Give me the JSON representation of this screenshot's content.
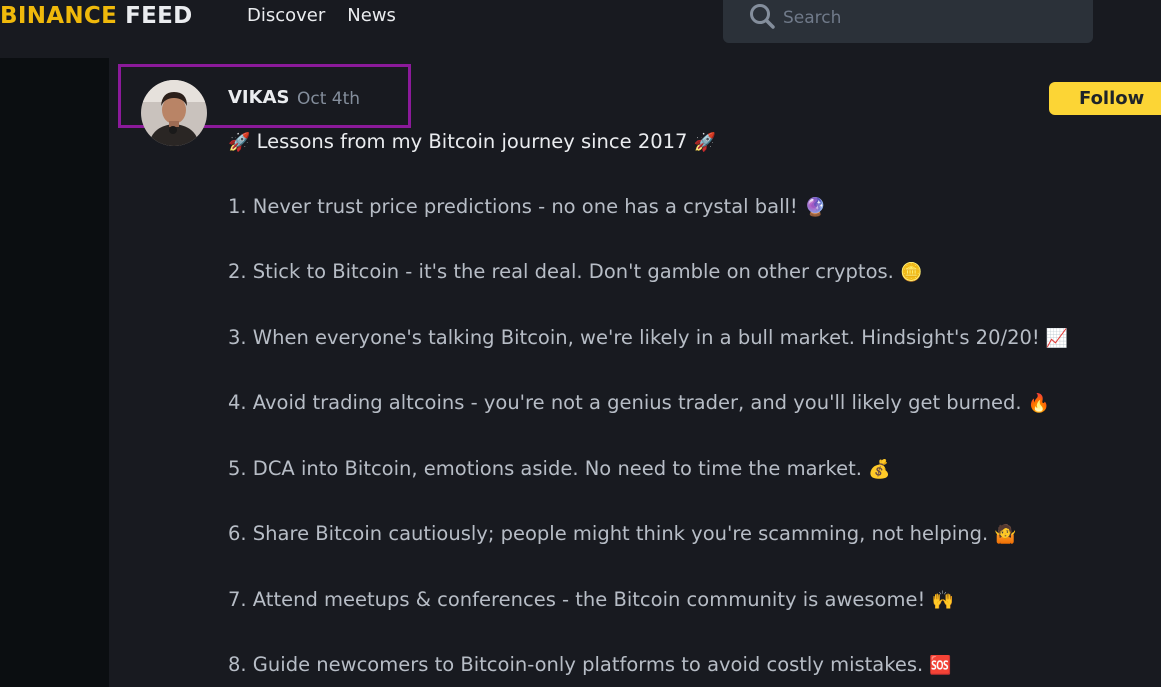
{
  "header": {
    "brand": "BINANCE",
    "feed": "FEED",
    "nav": [
      "Discover",
      "News"
    ],
    "search_placeholder": "Search"
  },
  "post": {
    "author": "VIKAS",
    "date": "Oct 4th",
    "follow_label": "Follow",
    "lines": [
      {
        "text": "Lessons from my Bitcoin journey since 2017",
        "emoji_before": "🚀",
        "emoji": "🚀"
      },
      {
        "text": "1. Never trust price predictions - no one has a crystal ball!",
        "emoji": "🔮"
      },
      {
        "text": "2. Stick to Bitcoin - it's the real deal. Don't gamble on other cryptos.",
        "emoji": "🪙"
      },
      {
        "text": "3. When everyone's talking Bitcoin, we're likely in a bull market. Hindsight's 20/20!",
        "emoji": "📈"
      },
      {
        "text": "4. Avoid trading altcoins - you're not a genius trader, and you'll likely get burned.",
        "emoji": "🔥"
      },
      {
        "text": "5. DCA into Bitcoin, emotions aside. No need to time the market.",
        "emoji": "💰"
      },
      {
        "text": "6. Share Bitcoin cautiously; people might think you're scamming, not helping.",
        "emoji": "🤷"
      },
      {
        "text": "7. Attend meetups & conferences - the Bitcoin community is awesome!",
        "emoji": "🙌"
      },
      {
        "text": "8. Guide newcomers to Bitcoin-only platforms to avoid costly mistakes.",
        "emoji": "🆘"
      }
    ]
  },
  "colors": {
    "brand": "#f0b90b",
    "follow_bg": "#fcd535",
    "highlight": "#8b1a9a",
    "bg": "#181a20",
    "sidebar": "#0b0e11"
  }
}
